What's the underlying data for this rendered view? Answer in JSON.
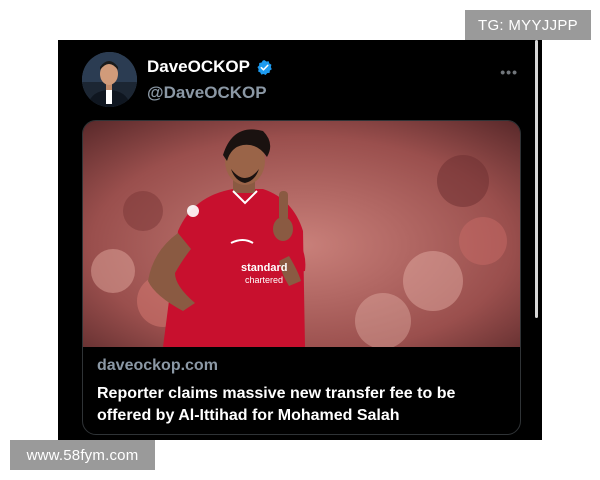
{
  "watermarks": {
    "telegram": "TG: MYYJJPP",
    "site": "www.58fym.com"
  },
  "tweet": {
    "display_name": "DaveOCKOP",
    "handle": "@DaveOCKOP",
    "verified": true,
    "verified_color": "#1d9bf0",
    "more_icon": "more-horizontal-icon",
    "card": {
      "domain": "daveockop.com",
      "title": "Reporter claims massive new transfer fee to be offered by Al-Ittihad for Mohamed Salah",
      "image_alt": "Footballer in red Liverpool kit raising one finger"
    }
  },
  "colors": {
    "background": "#000000",
    "secondary_text": "#8b98a5",
    "kit_red": "#c8102e"
  }
}
